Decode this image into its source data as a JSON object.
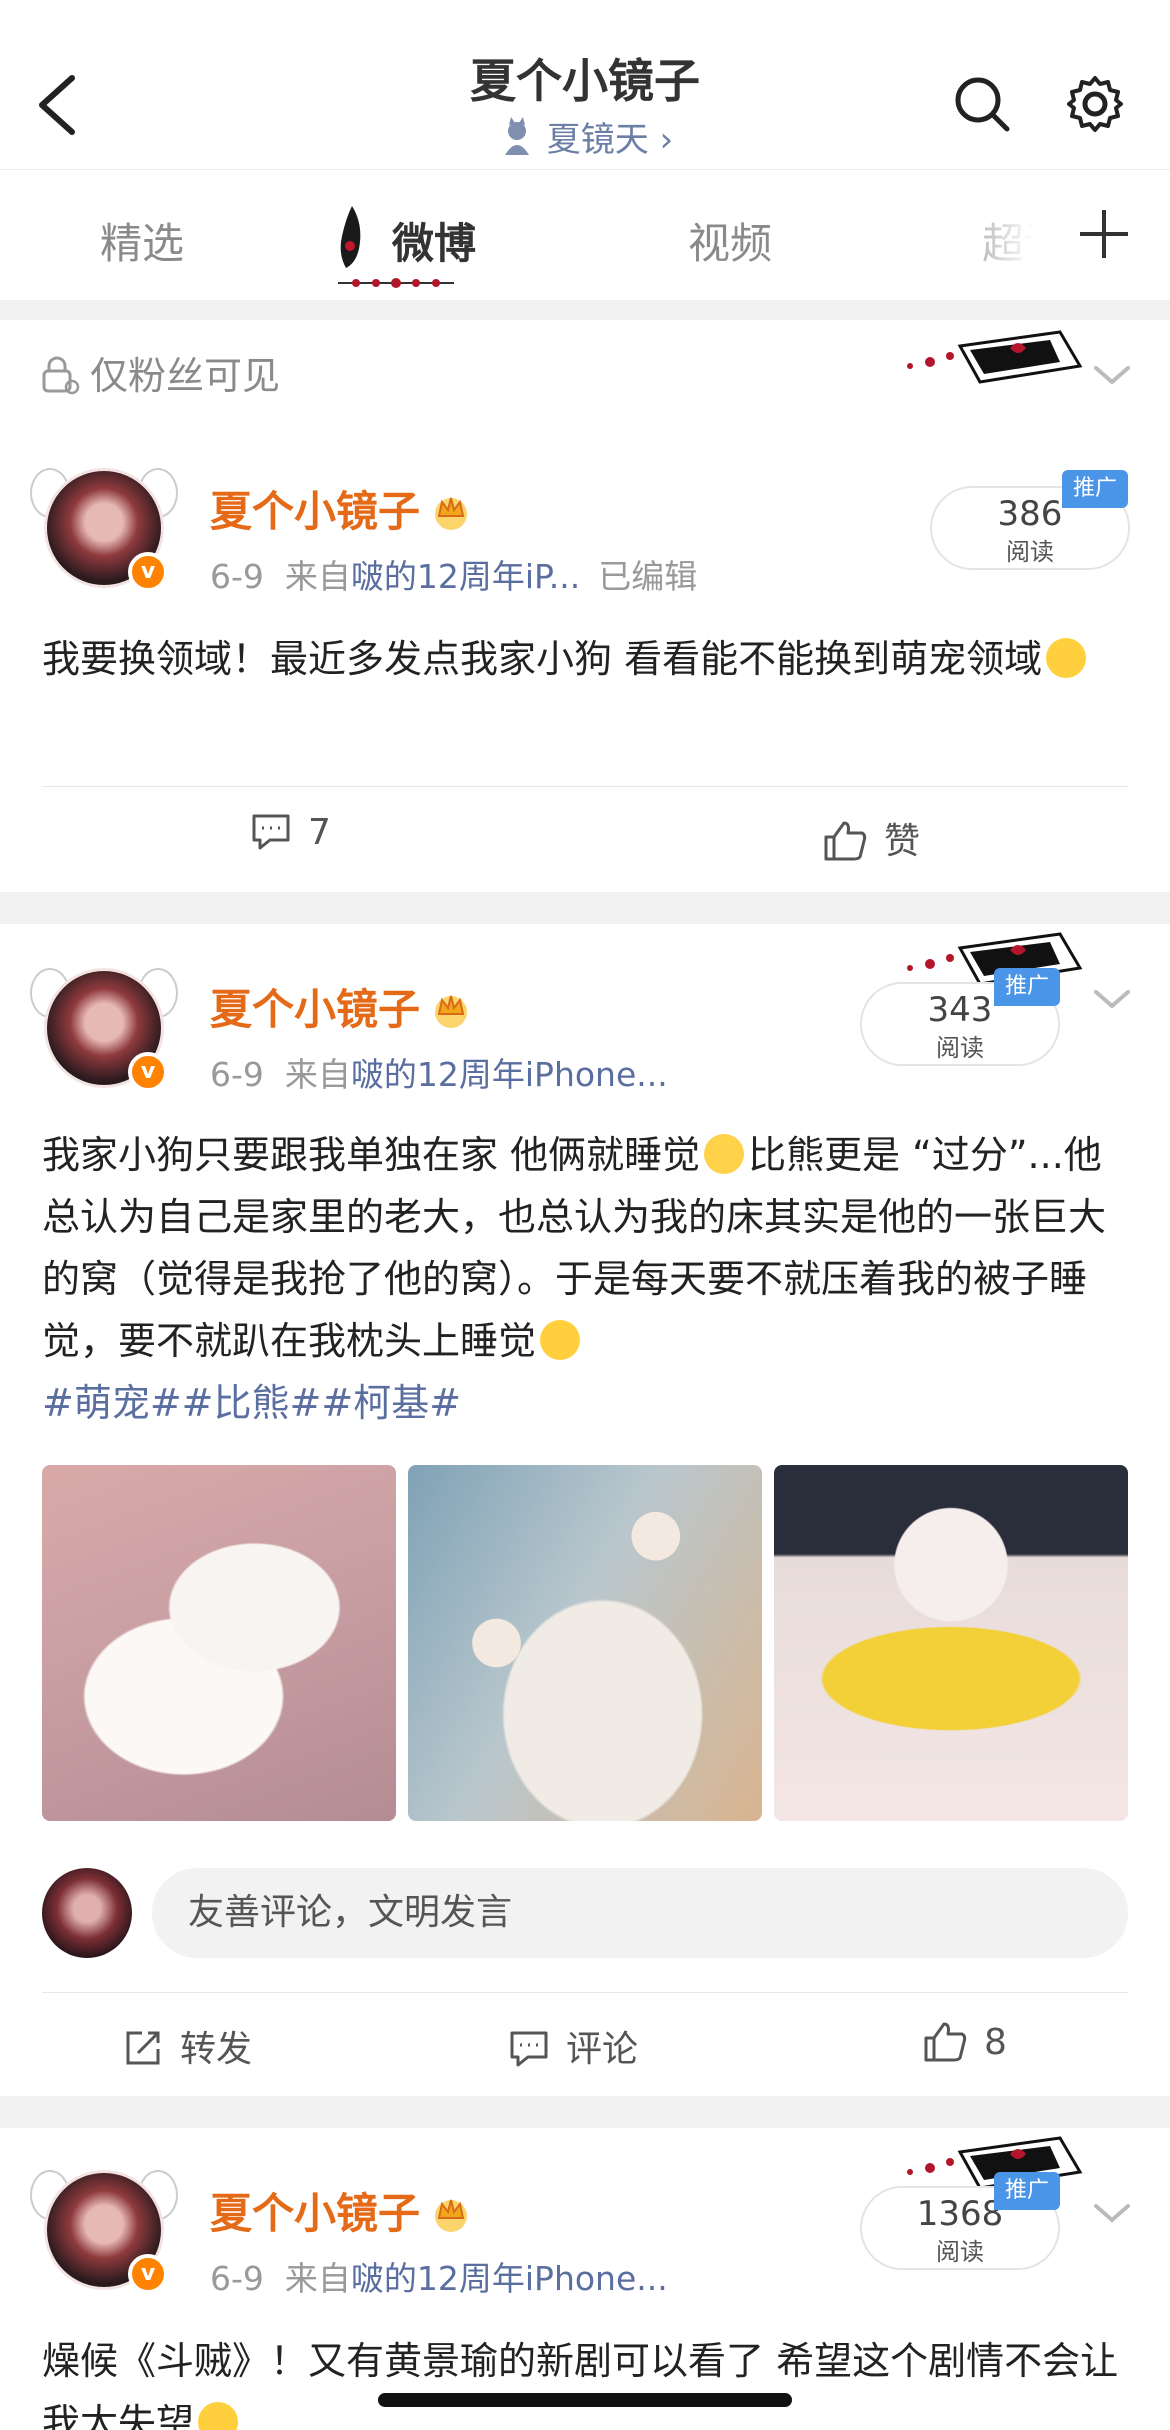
{
  "header": {
    "title": "夏个小镜子",
    "subtitle": "夏镜天",
    "subtitle_chevron": "›",
    "icons": [
      "back-chevron-icon",
      "search-icon",
      "gear-icon"
    ]
  },
  "tabs": [
    "精选",
    "微博",
    "视频",
    "超话"
  ],
  "active_tab": "微博",
  "colors": {
    "accent_orange": "#e46a17",
    "link_blue": "#5a6ea0",
    "promo_blue": "#4b95e8",
    "verified_orange": "#ff8200"
  },
  "posts": [
    {
      "visibility": "仅粉丝可见",
      "username": "夏个小镜子",
      "verified_badge": "v",
      "date": "6-9",
      "source_prefix": "来自",
      "source": "啵的12周年iP...",
      "edited": "已编辑",
      "reads": "386",
      "reads_label": "阅读",
      "promo_label": "推广",
      "text": "我要换领域！最近多发点我家小狗 看看能不能换到萌宠领域",
      "actions": {
        "comment_count": "7",
        "like_label": "赞"
      }
    },
    {
      "username": "夏个小镜子",
      "verified_badge": "v",
      "date": "6-9",
      "source_prefix": "来自",
      "source": "啵的12周年iPhone...",
      "reads": "343",
      "reads_label": "阅读",
      "promo_label": "推广",
      "text_1": "我家小狗只要跟我单独在家 他俩就睡觉",
      "text_2": "比熊更是 “过分”...他总认为自己是家里的老大，也总认为我的床其实是他的一张巨大的窝（觉得是我抢了他的窝）。于是每天要不就压着我的被子睡觉，要不就趴在我枕头上睡觉",
      "tags": "#萌宠##比熊##柯基#",
      "comment_placeholder": "友善评论，文明发言",
      "actions": {
        "repost_label": "转发",
        "comment_label": "评论",
        "like_count": "8"
      }
    },
    {
      "username": "夏个小镜子",
      "verified_badge": "v",
      "date": "6-9",
      "source_prefix": "来自",
      "source": "啵的12周年iPhone...",
      "reads": "1368",
      "reads_label": "阅读",
      "promo_label": "推广",
      "text": "燥候《斗贼》！又有黄景瑜的新剧可以看了 希望这个剧情不会让我太失望"
    }
  ]
}
